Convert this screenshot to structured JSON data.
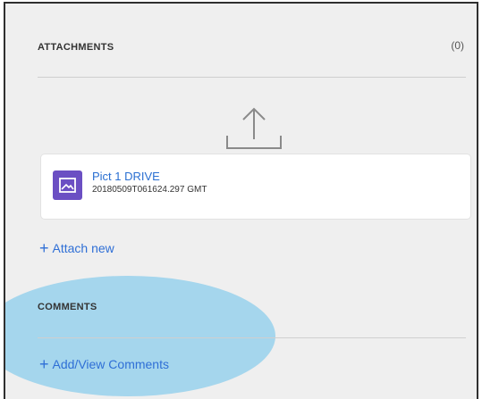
{
  "attachments": {
    "title": "ATTACHMENTS",
    "count": "(0)",
    "upload_icon": "upload-icon",
    "files": [
      {
        "name": "Pict 1 DRIVE",
        "timestamp": "20180509T061624.297 GMT",
        "icon": "image-icon",
        "icon_color": "#6b4fc3"
      }
    ],
    "attach_label": "Attach new"
  },
  "comments": {
    "title": "COMMENTS",
    "add_label": "Add/View Comments"
  },
  "colors": {
    "link": "#2f6fd6",
    "highlight": "#7dc8eb",
    "panel_bg": "#efefef"
  }
}
